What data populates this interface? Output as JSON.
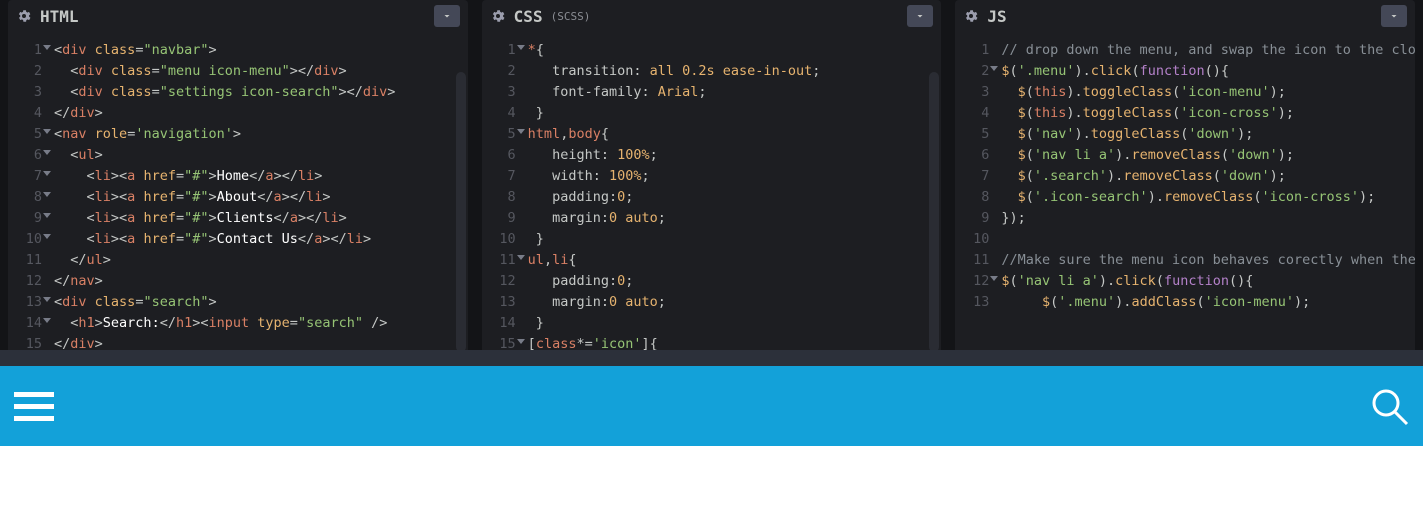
{
  "panels": {
    "html": {
      "title": "HTML",
      "sub": ""
    },
    "css": {
      "title": "CSS",
      "sub": "(SCSS)"
    },
    "js": {
      "title": "JS",
      "sub": ""
    }
  },
  "html_lines": {
    "l1": {
      "a": "<",
      "b": "div",
      "c": " ",
      "d": "class",
      "e": "=",
      "f": "\"navbar\"",
      "g": ">"
    },
    "l2": {
      "a": "  <",
      "b": "div",
      "c": " ",
      "d": "class",
      "e": "=",
      "f": "\"menu icon-menu\"",
      "g": "></",
      "h": "div",
      "i": ">"
    },
    "l3": {
      "a": "  <",
      "b": "div",
      "c": " ",
      "d": "class",
      "e": "=",
      "f": "\"settings icon-search\"",
      "g": "></",
      "h": "div",
      "i": ">"
    },
    "l4": {
      "a": "</",
      "b": "div",
      "c": ">"
    },
    "l5": {
      "a": "<",
      "b": "nav",
      "c": " ",
      "d": "role",
      "e": "=",
      "f": "'navigation'",
      "g": ">"
    },
    "l6": {
      "a": "  <",
      "b": "ul",
      "c": ">"
    },
    "l7": {
      "a": "    <",
      "b": "li",
      "c": "><",
      "d": "a",
      "e": " ",
      "f": "href",
      "g": "=",
      "h": "\"#\"",
      "i": ">",
      "j": "Home",
      "k": "</",
      "l": "a",
      "m": "></",
      "n": "li",
      "o": ">"
    },
    "l8": {
      "a": "    <",
      "b": "li",
      "c": "><",
      "d": "a",
      "e": " ",
      "f": "href",
      "g": "=",
      "h": "\"#\"",
      "i": ">",
      "j": "About",
      "k": "</",
      "l": "a",
      "m": "></",
      "n": "li",
      "o": ">"
    },
    "l9": {
      "a": "    <",
      "b": "li",
      "c": "><",
      "d": "a",
      "e": " ",
      "f": "href",
      "g": "=",
      "h": "\"#\"",
      "i": ">",
      "j": "Clients",
      "k": "</",
      "l": "a",
      "m": "></",
      "n": "li",
      "o": ">"
    },
    "l10": {
      "a": "    <",
      "b": "li",
      "c": "><",
      "d": "a",
      "e": " ",
      "f": "href",
      "g": "=",
      "h": "\"#\"",
      "i": ">",
      "j": "Contact Us",
      "k": "</",
      "l": "a",
      "m": "></",
      "n": "li",
      "o": ">"
    },
    "l11": {
      "a": "  </",
      "b": "ul",
      "c": ">"
    },
    "l12": {
      "a": "</",
      "b": "nav",
      "c": ">"
    },
    "l13": {
      "a": "<",
      "b": "div",
      "c": " ",
      "d": "class",
      "e": "=",
      "f": "\"search\"",
      "g": ">"
    },
    "l14": {
      "a": "  <",
      "b": "h1",
      "c": ">",
      "d": "Search:",
      "e": "</",
      "f": "h1",
      "g": "><",
      "h": "input",
      "i": " ",
      "j": "type",
      "k": "=",
      "l": "\"search\"",
      "m": " />"
    },
    "l15": {
      "a": "</",
      "b": "div",
      "c": ">"
    }
  },
  "css_lines": {
    "l1": {
      "a": "*",
      "b": "{"
    },
    "l2": {
      "a": "   ",
      "b": "transition",
      "c": ": ",
      "d": "all",
      "e": " ",
      "f": "0.2s",
      "g": " ",
      "h": "ease-in-out",
      "i": ";"
    },
    "l3": {
      "a": "   ",
      "b": "font-family",
      "c": ": ",
      "d": "Arial",
      "e": ";"
    },
    "l4": {
      "a": " }"
    },
    "l5": {
      "a": "html",
      "b": ",",
      "c": "body",
      "d": "{"
    },
    "l6": {
      "a": "   ",
      "b": "height",
      "c": ": ",
      "d": "100%",
      "e": ";"
    },
    "l7": {
      "a": "   ",
      "b": "width",
      "c": ": ",
      "d": "100%",
      "e": ";"
    },
    "l8": {
      "a": "   ",
      "b": "padding",
      "c": ":",
      "d": "0",
      "e": ";"
    },
    "l9": {
      "a": "   ",
      "b": "margin",
      "c": ":",
      "d": "0",
      "e": " ",
      "f": "auto",
      "g": ";"
    },
    "l10": {
      "a": " }"
    },
    "l11": {
      "a": "ul",
      "b": ",",
      "c": "li",
      "d": "{"
    },
    "l12": {
      "a": "   ",
      "b": "padding",
      "c": ":",
      "d": "0",
      "e": ";"
    },
    "l13": {
      "a": "   ",
      "b": "margin",
      "c": ":",
      "d": "0",
      "e": " ",
      "f": "auto",
      "g": ";"
    },
    "l14": {
      "a": " }"
    },
    "l15": {
      "a": "[",
      "b": "class",
      "c": "*=",
      "d": "'icon'",
      "e": "]{"
    }
  },
  "js_lines": {
    "l1": {
      "a": "// drop down the menu, and swap the icon to the close icon"
    },
    "l2": {
      "a": "$",
      "b": "(",
      "c": "'.menu'",
      "d": ").",
      "e": "click",
      "f": "(",
      "g": "function",
      "h": "(){"
    },
    "l3": {
      "a": "  ",
      "b": "$",
      "c": "(",
      "d": "this",
      "e": ").",
      "f": "toggleClass",
      "g": "(",
      "h": "'icon-menu'",
      "i": ");"
    },
    "l4": {
      "a": "  ",
      "b": "$",
      "c": "(",
      "d": "this",
      "e": ").",
      "f": "toggleClass",
      "g": "(",
      "h": "'icon-cross'",
      "i": ");"
    },
    "l5": {
      "a": "  ",
      "b": "$",
      "c": "(",
      "d": "'nav'",
      "e": ").",
      "f": "toggleClass",
      "g": "(",
      "h": "'down'",
      "i": ");"
    },
    "l6": {
      "a": "  ",
      "b": "$",
      "c": "(",
      "d": "'nav li a'",
      "e": ").",
      "f": "removeClass",
      "g": "(",
      "h": "'down'",
      "i": ");"
    },
    "l7": {
      "a": "  ",
      "b": "$",
      "c": "(",
      "d": "'.search'",
      "e": ").",
      "f": "removeClass",
      "g": "(",
      "h": "'down'",
      "i": ");"
    },
    "l8": {
      "a": "  ",
      "b": "$",
      "c": "(",
      "d": "'.icon-search'",
      "e": ").",
      "f": "removeClass",
      "g": "(",
      "h": "'icon-cross'",
      "i": ");"
    },
    "l9": {
      "a": "});"
    },
    "l10": {
      "a": ""
    },
    "l11": {
      "a": "//Make sure the menu icon behaves corectly when the menu is open"
    },
    "l12": {
      "a": "$",
      "b": "(",
      "c": "'nav li a'",
      "d": ").",
      "e": "click",
      "f": "(",
      "g": "function",
      "h": "(){"
    },
    "l13": {
      "a": "     ",
      "b": "$",
      "c": "(",
      "d": "'.menu'",
      "e": ").",
      "f": "addClass",
      "g": "(",
      "h": "'icon-menu'",
      "i": ");"
    }
  },
  "gutters": {
    "html": [
      "1",
      "2",
      "3",
      "4",
      "5",
      "6",
      "7",
      "8",
      "9",
      "10",
      "11",
      "12",
      "13",
      "14",
      "15"
    ],
    "css": [
      "1",
      "2",
      "3",
      "4",
      "5",
      "6",
      "7",
      "8",
      "9",
      "10",
      "11",
      "12",
      "13",
      "14",
      "15"
    ],
    "js": [
      "1",
      "2",
      "3",
      "4",
      "5",
      "6",
      "7",
      "8",
      "9",
      "10",
      "11",
      "12",
      "13"
    ]
  },
  "html_folds": [
    0,
    4,
    5,
    6,
    7,
    8,
    9,
    12,
    13
  ],
  "css_folds": [
    0,
    4,
    10,
    14
  ],
  "js_folds": [
    1,
    11
  ]
}
